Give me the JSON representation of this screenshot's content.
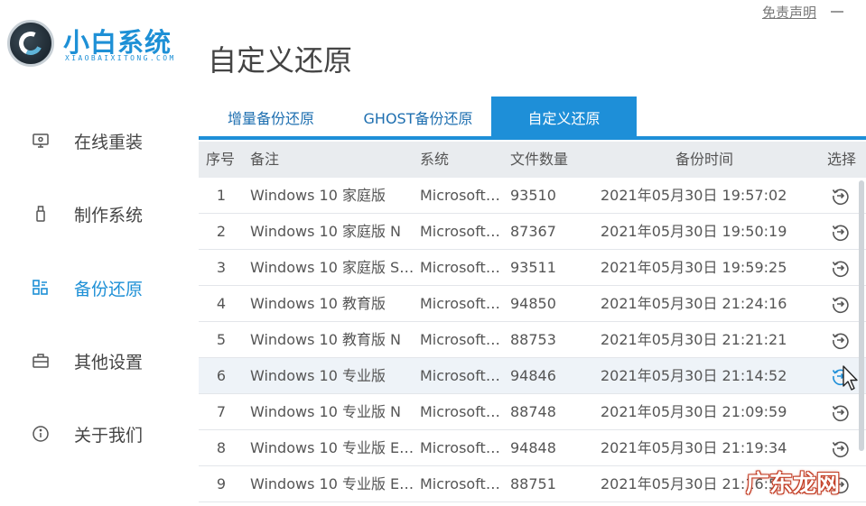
{
  "logo": {
    "name_cn": "小白系统",
    "name_en": "XIAOBAIXITONG.COM"
  },
  "page_title": "自定义还原",
  "header": {
    "disclaimer": "免责声明"
  },
  "sidebar": {
    "items": [
      {
        "label": "在线重装",
        "icon": "monitor-icon",
        "active": false
      },
      {
        "label": "制作系统",
        "icon": "usb-icon",
        "active": false
      },
      {
        "label": "备份还原",
        "icon": "backup-icon",
        "active": true
      },
      {
        "label": "其他设置",
        "icon": "briefcase-icon",
        "active": false
      },
      {
        "label": "关于我们",
        "icon": "info-icon",
        "active": false
      }
    ]
  },
  "tabs": [
    {
      "label": "增量备份还原",
      "active": false
    },
    {
      "label": "GHOST备份还原",
      "active": false
    },
    {
      "label": "自定义还原",
      "active": true
    }
  ],
  "table": {
    "headers": {
      "idx": "序号",
      "note": "备注",
      "system": "系统",
      "count": "文件数量",
      "time": "备份时间",
      "select": "选择"
    },
    "rows": [
      {
        "idx": "1",
        "note": "Windows 10 家庭版",
        "system": "Microsoft…",
        "count": "93510",
        "time": "2021年05月30日 19:57:02"
      },
      {
        "idx": "2",
        "note": "Windows 10 家庭版 N",
        "system": "Microsoft…",
        "count": "87367",
        "time": "2021年05月30日 19:50:19"
      },
      {
        "idx": "3",
        "note": "Windows 10 家庭版 S…",
        "system": "Microsoft…",
        "count": "93511",
        "time": "2021年05月30日 19:59:25"
      },
      {
        "idx": "4",
        "note": "Windows 10 教育版",
        "system": "Microsoft…",
        "count": "94850",
        "time": "2021年05月30日 21:24:16"
      },
      {
        "idx": "5",
        "note": "Windows 10 教育版 N",
        "system": "Microsoft…",
        "count": "88753",
        "time": "2021年05月30日 21:21:21"
      },
      {
        "idx": "6",
        "note": "Windows 10 专业版",
        "system": "Microsoft…",
        "count": "94846",
        "time": "2021年05月30日 21:14:52"
      },
      {
        "idx": "7",
        "note": "Windows 10 专业版 N",
        "system": "Microsoft…",
        "count": "88748",
        "time": "2021年05月30日 21:09:59"
      },
      {
        "idx": "8",
        "note": "Windows 10 专业版 E…",
        "system": "Microsoft…",
        "count": "94848",
        "time": "2021年05月30日 21:19:34"
      },
      {
        "idx": "9",
        "note": "Windows 10 专业版 E…",
        "system": "Microsoft…",
        "count": "88751",
        "time": "2021年05月30日 21:16:59"
      }
    ]
  },
  "watermark": "广东龙网",
  "colors": {
    "accent": "#1e8fd8",
    "header_bg": "#e9ecef",
    "hover_row": "#eef3f8"
  }
}
